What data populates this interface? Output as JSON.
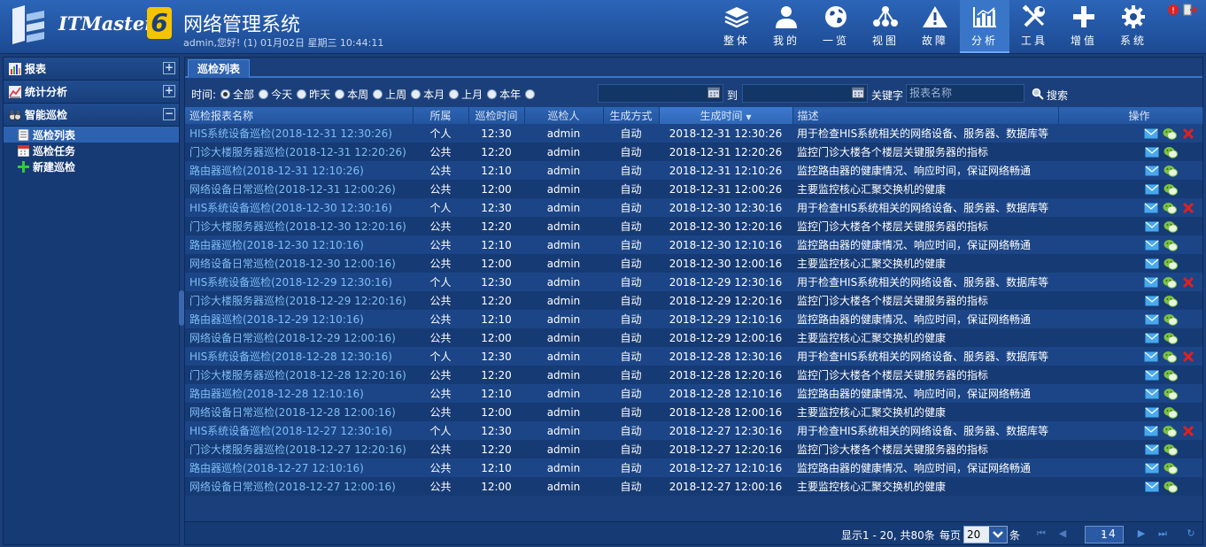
{
  "header": {
    "brand": "ITMaster",
    "version": "6",
    "title": "网络管理系统",
    "user_info": "admin,您好! (1) 01月02日 星期三 10:44:11"
  },
  "nav": [
    {
      "label": "整体",
      "icon": "layers-icon"
    },
    {
      "label": "我的",
      "icon": "user-icon"
    },
    {
      "label": "一览",
      "icon": "globe-icon"
    },
    {
      "label": "视图",
      "icon": "topology-icon"
    },
    {
      "label": "故障",
      "icon": "warning-icon"
    },
    {
      "label": "分析",
      "icon": "bar-chart-icon",
      "active": true
    },
    {
      "label": "工具",
      "icon": "tools-icon"
    },
    {
      "label": "增值",
      "icon": "plus-icon"
    },
    {
      "label": "系统",
      "icon": "gear-icon"
    }
  ],
  "sidebar": {
    "groups": [
      {
        "label": "报表",
        "toggle": "+"
      },
      {
        "label": "统计分析",
        "toggle": "+"
      },
      {
        "label": "智能巡检",
        "toggle": "−"
      }
    ],
    "items": [
      {
        "label": "巡检列表",
        "active": true
      },
      {
        "label": "巡检任务"
      },
      {
        "label": "新建巡检"
      }
    ]
  },
  "main": {
    "tab": "巡检列表",
    "filter": {
      "time_label": "时间:",
      "radios": [
        "全部",
        "今天",
        "昨天",
        "本周",
        "上周",
        "本月",
        "上月",
        "本年"
      ],
      "to_label": "到",
      "keyword_label": "关键字",
      "keyword_placeholder": "报表名称",
      "search_label": "搜索"
    },
    "columns": [
      "巡检报表名称",
      "所属",
      "巡检时间",
      "巡检人",
      "生成方式",
      "生成时间",
      "描述",
      "操作"
    ],
    "rows": [
      {
        "name": "HIS系统设备巡检(2018-12-31 12:30:26)",
        "owner": "个人",
        "time": "12:30",
        "user": "admin",
        "mode": "自动",
        "generated": "2018-12-31 12:30:26",
        "desc": "用于检查HIS系统相关的网络设备、服务器、数据库等",
        "del": true
      },
      {
        "name": "门诊大楼服务器巡检(2018-12-31 12:20:26)",
        "owner": "公共",
        "time": "12:20",
        "user": "admin",
        "mode": "自动",
        "generated": "2018-12-31 12:20:26",
        "desc": "监控门诊大楼各个楼层关键服务器的指标",
        "del": false
      },
      {
        "name": "路由器巡检(2018-12-31 12:10:26)",
        "owner": "公共",
        "time": "12:10",
        "user": "admin",
        "mode": "自动",
        "generated": "2018-12-31 12:10:26",
        "desc": "监控路由器的健康情况、响应时间，保证网络畅通",
        "del": false
      },
      {
        "name": "网络设备日常巡检(2018-12-31 12:00:26)",
        "owner": "公共",
        "time": "12:00",
        "user": "admin",
        "mode": "自动",
        "generated": "2018-12-31 12:00:26",
        "desc": "主要监控核心汇聚交换机的健康",
        "del": false
      },
      {
        "name": "HIS系统设备巡检(2018-12-30 12:30:16)",
        "owner": "个人",
        "time": "12:30",
        "user": "admin",
        "mode": "自动",
        "generated": "2018-12-30 12:30:16",
        "desc": "用于检查HIS系统相关的网络设备、服务器、数据库等",
        "del": true
      },
      {
        "name": "门诊大楼服务器巡检(2018-12-30 12:20:16)",
        "owner": "公共",
        "time": "12:20",
        "user": "admin",
        "mode": "自动",
        "generated": "2018-12-30 12:20:16",
        "desc": "监控门诊大楼各个楼层关键服务器的指标",
        "del": false
      },
      {
        "name": "路由器巡检(2018-12-30 12:10:16)",
        "owner": "公共",
        "time": "12:10",
        "user": "admin",
        "mode": "自动",
        "generated": "2018-12-30 12:10:16",
        "desc": "监控路由器的健康情况、响应时间，保证网络畅通",
        "del": false
      },
      {
        "name": "网络设备日常巡检(2018-12-30 12:00:16)",
        "owner": "公共",
        "time": "12:00",
        "user": "admin",
        "mode": "自动",
        "generated": "2018-12-30 12:00:16",
        "desc": "主要监控核心汇聚交换机的健康",
        "del": false
      },
      {
        "name": "HIS系统设备巡检(2018-12-29 12:30:16)",
        "owner": "个人",
        "time": "12:30",
        "user": "admin",
        "mode": "自动",
        "generated": "2018-12-29 12:30:16",
        "desc": "用于检查HIS系统相关的网络设备、服务器、数据库等",
        "del": true
      },
      {
        "name": "门诊大楼服务器巡检(2018-12-29 12:20:16)",
        "owner": "公共",
        "time": "12:20",
        "user": "admin",
        "mode": "自动",
        "generated": "2018-12-29 12:20:16",
        "desc": "监控门诊大楼各个楼层关键服务器的指标",
        "del": false
      },
      {
        "name": "路由器巡检(2018-12-29 12:10:16)",
        "owner": "公共",
        "time": "12:10",
        "user": "admin",
        "mode": "自动",
        "generated": "2018-12-29 12:10:16",
        "desc": "监控路由器的健康情况、响应时间，保证网络畅通",
        "del": false
      },
      {
        "name": "网络设备日常巡检(2018-12-29 12:00:16)",
        "owner": "公共",
        "time": "12:00",
        "user": "admin",
        "mode": "自动",
        "generated": "2018-12-29 12:00:16",
        "desc": "主要监控核心汇聚交换机的健康",
        "del": false
      },
      {
        "name": "HIS系统设备巡检(2018-12-28 12:30:16)",
        "owner": "个人",
        "time": "12:30",
        "user": "admin",
        "mode": "自动",
        "generated": "2018-12-28 12:30:16",
        "desc": "用于检查HIS系统相关的网络设备、服务器、数据库等",
        "del": true
      },
      {
        "name": "门诊大楼服务器巡检(2018-12-28 12:20:16)",
        "owner": "公共",
        "time": "12:20",
        "user": "admin",
        "mode": "自动",
        "generated": "2018-12-28 12:20:16",
        "desc": "监控门诊大楼各个楼层关键服务器的指标",
        "del": false
      },
      {
        "name": "路由器巡检(2018-12-28 12:10:16)",
        "owner": "公共",
        "time": "12:10",
        "user": "admin",
        "mode": "自动",
        "generated": "2018-12-28 12:10:16",
        "desc": "监控路由器的健康情况、响应时间，保证网络畅通",
        "del": false
      },
      {
        "name": "网络设备日常巡检(2018-12-28 12:00:16)",
        "owner": "公共",
        "time": "12:00",
        "user": "admin",
        "mode": "自动",
        "generated": "2018-12-28 12:00:16",
        "desc": "主要监控核心汇聚交换机的健康",
        "del": false
      },
      {
        "name": "HIS系统设备巡检(2018-12-27 12:30:16)",
        "owner": "个人",
        "time": "12:30",
        "user": "admin",
        "mode": "自动",
        "generated": "2018-12-27 12:30:16",
        "desc": "用于检查HIS系统相关的网络设备、服务器、数据库等",
        "del": true
      },
      {
        "name": "门诊大楼服务器巡检(2018-12-27 12:20:16)",
        "owner": "公共",
        "time": "12:20",
        "user": "admin",
        "mode": "自动",
        "generated": "2018-12-27 12:20:16",
        "desc": "监控门诊大楼各个楼层关键服务器的指标",
        "del": false
      },
      {
        "name": "路由器巡检(2018-12-27 12:10:16)",
        "owner": "公共",
        "time": "12:10",
        "user": "admin",
        "mode": "自动",
        "generated": "2018-12-27 12:10:16",
        "desc": "监控路由器的健康情况、响应时间，保证网络畅通",
        "del": false
      },
      {
        "name": "网络设备日常巡检(2018-12-27 12:00:16)",
        "owner": "公共",
        "time": "12:00",
        "user": "admin",
        "mode": "自动",
        "generated": "2018-12-27 12:00:16",
        "desc": "主要监控核心汇聚交换机的健康",
        "del": false
      }
    ],
    "pager": {
      "summary": "显示1 - 20, 共80条",
      "per_page_label": "每页",
      "per_page_value": "20",
      "unit": "条",
      "page_current": "1",
      "page_total": "- 4"
    }
  }
}
